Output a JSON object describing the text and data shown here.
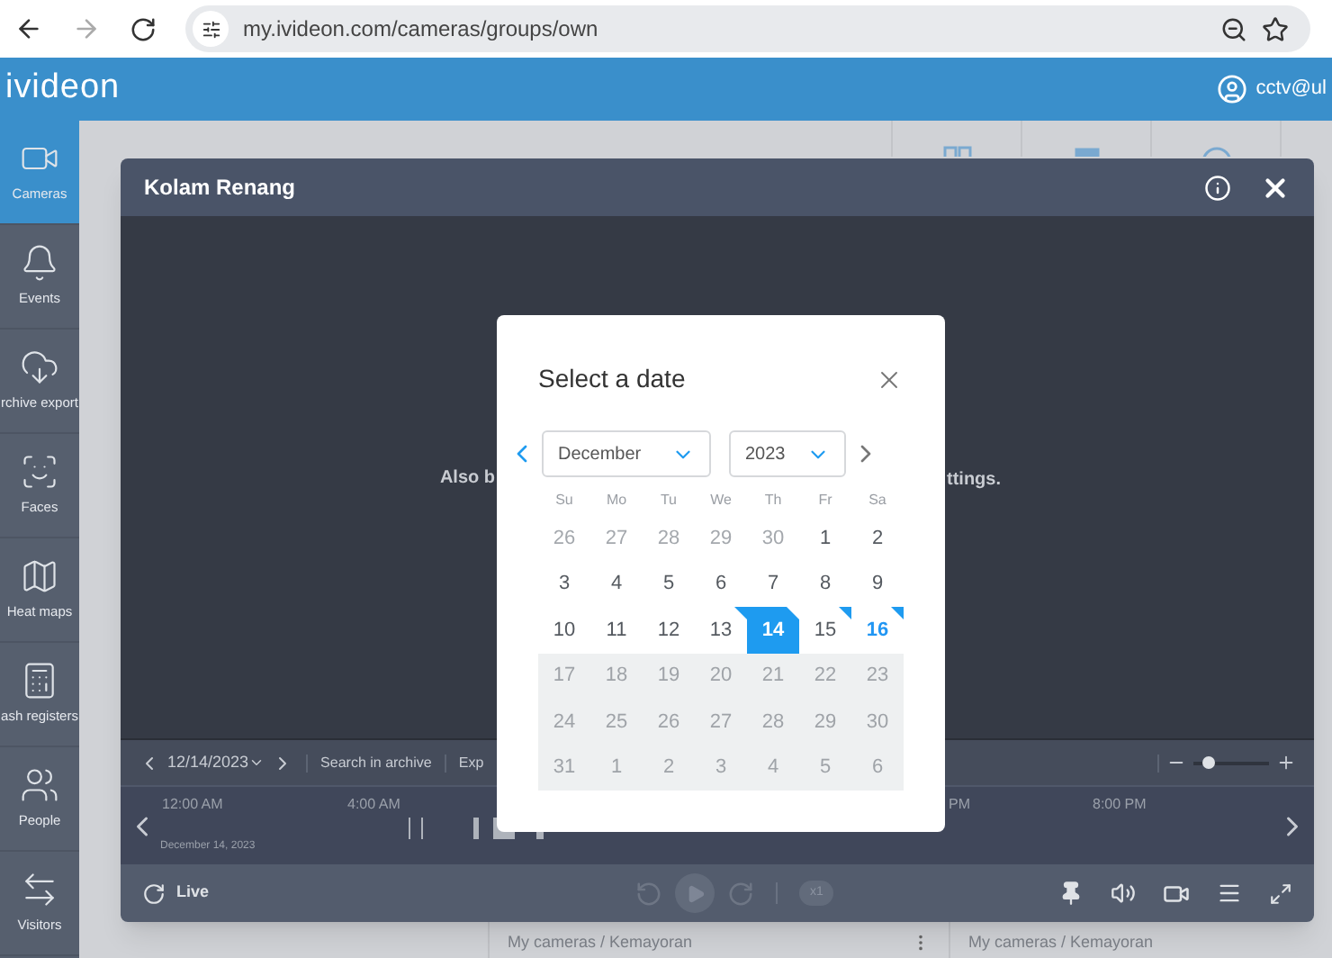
{
  "browser": {
    "url": "my.ivideon.com/cameras/groups/own",
    "forward_disabled": true
  },
  "header": {
    "logo": "ivideon",
    "user": "cctv@ul"
  },
  "sidebar": {
    "items": [
      {
        "label": "Cameras",
        "kind": "camera",
        "selected": true
      },
      {
        "label": "Events",
        "kind": "bell",
        "selected": false
      },
      {
        "label": "rchive export",
        "kind": "cloud",
        "selected": false
      },
      {
        "label": "Faces",
        "kind": "face",
        "selected": false
      },
      {
        "label": "Heat maps",
        "kind": "map",
        "selected": false
      },
      {
        "label": "ash registers",
        "kind": "register",
        "selected": false
      },
      {
        "label": "People",
        "kind": "people",
        "selected": false
      },
      {
        "label": "Visitors",
        "kind": "visitors",
        "selected": false
      }
    ]
  },
  "page": {
    "cards": [
      {
        "subtitle": "My cameras / Kemayoran"
      },
      {
        "subtitle": "My cameras / Kemayoran"
      }
    ]
  },
  "player": {
    "title": "Kolam Renang",
    "message_left": "Also b",
    "message_right": "ttings.",
    "date": "12/14/2023",
    "search": "Search in archive",
    "export": "Exp",
    "zoom": {
      "level": 0.2
    },
    "timeline": {
      "ticks": [
        {
          "label": "12:00 AM"
        },
        {
          "label": "4:00 AM"
        },
        {
          "label": "PM"
        },
        {
          "label": "8:00 PM"
        }
      ],
      "date": "December 14, 2023"
    },
    "live": "Live",
    "speed": "x1"
  },
  "date_dialog": {
    "title": "Select a date",
    "month": "December",
    "year": "2023",
    "weekdays": [
      "Su",
      "Mo",
      "Tu",
      "We",
      "Th",
      "Fr",
      "Sa"
    ],
    "days": [
      {
        "label": "26",
        "kind": "outside",
        "selected": false,
        "recorded": false,
        "today": false
      },
      {
        "label": "27",
        "kind": "outside",
        "selected": false,
        "recorded": false,
        "today": false
      },
      {
        "label": "28",
        "kind": "outside",
        "selected": false,
        "recorded": false,
        "today": false
      },
      {
        "label": "29",
        "kind": "outside",
        "selected": false,
        "recorded": false,
        "today": false
      },
      {
        "label": "30",
        "kind": "outside",
        "selected": false,
        "recorded": false,
        "today": false
      },
      {
        "label": "1",
        "kind": "normal",
        "selected": false,
        "recorded": false,
        "today": false
      },
      {
        "label": "2",
        "kind": "normal",
        "selected": false,
        "recorded": false,
        "today": false
      },
      {
        "label": "3",
        "kind": "normal",
        "selected": false,
        "recorded": false,
        "today": false
      },
      {
        "label": "4",
        "kind": "normal",
        "selected": false,
        "recorded": false,
        "today": false
      },
      {
        "label": "5",
        "kind": "normal",
        "selected": false,
        "recorded": false,
        "today": false
      },
      {
        "label": "6",
        "kind": "normal",
        "selected": false,
        "recorded": false,
        "today": false
      },
      {
        "label": "7",
        "kind": "normal",
        "selected": false,
        "recorded": false,
        "today": false
      },
      {
        "label": "8",
        "kind": "normal",
        "selected": false,
        "recorded": false,
        "today": false
      },
      {
        "label": "9",
        "kind": "normal",
        "selected": false,
        "recorded": false,
        "today": false
      },
      {
        "label": "10",
        "kind": "normal",
        "selected": false,
        "recorded": false,
        "today": false
      },
      {
        "label": "11",
        "kind": "normal",
        "selected": false,
        "recorded": false,
        "today": false
      },
      {
        "label": "12",
        "kind": "normal",
        "selected": false,
        "recorded": false,
        "today": false
      },
      {
        "label": "13",
        "kind": "normal",
        "selected": false,
        "recorded": true,
        "today": false
      },
      {
        "label": "14",
        "kind": "normal",
        "selected": true,
        "recorded": true,
        "today": false
      },
      {
        "label": "15",
        "kind": "normal",
        "selected": false,
        "recorded": true,
        "today": false
      },
      {
        "label": "16",
        "kind": "normal",
        "selected": false,
        "recorded": true,
        "today": true
      },
      {
        "label": "17",
        "kind": "future",
        "selected": false,
        "recorded": false,
        "today": false
      },
      {
        "label": "18",
        "kind": "future",
        "selected": false,
        "recorded": false,
        "today": false
      },
      {
        "label": "19",
        "kind": "future",
        "selected": false,
        "recorded": false,
        "today": false
      },
      {
        "label": "20",
        "kind": "future",
        "selected": false,
        "recorded": false,
        "today": false
      },
      {
        "label": "21",
        "kind": "future",
        "selected": false,
        "recorded": false,
        "today": false
      },
      {
        "label": "22",
        "kind": "future",
        "selected": false,
        "recorded": false,
        "today": false
      },
      {
        "label": "23",
        "kind": "future",
        "selected": false,
        "recorded": false,
        "today": false
      },
      {
        "label": "24",
        "kind": "future",
        "selected": false,
        "recorded": false,
        "today": false
      },
      {
        "label": "25",
        "kind": "future",
        "selected": false,
        "recorded": false,
        "today": false
      },
      {
        "label": "26",
        "kind": "future",
        "selected": false,
        "recorded": false,
        "today": false
      },
      {
        "label": "27",
        "kind": "future",
        "selected": false,
        "recorded": false,
        "today": false
      },
      {
        "label": "28",
        "kind": "future",
        "selected": false,
        "recorded": false,
        "today": false
      },
      {
        "label": "29",
        "kind": "future",
        "selected": false,
        "recorded": false,
        "today": false
      },
      {
        "label": "30",
        "kind": "future",
        "selected": false,
        "recorded": false,
        "today": false
      },
      {
        "label": "31",
        "kind": "future",
        "selected": false,
        "recorded": false,
        "today": false
      },
      {
        "label": "1",
        "kind": "future",
        "selected": false,
        "recorded": false,
        "today": false
      },
      {
        "label": "2",
        "kind": "future",
        "selected": false,
        "recorded": false,
        "today": false
      },
      {
        "label": "3",
        "kind": "future",
        "selected": false,
        "recorded": false,
        "today": false
      },
      {
        "label": "4",
        "kind": "future",
        "selected": false,
        "recorded": false,
        "today": false
      },
      {
        "label": "5",
        "kind": "future",
        "selected": false,
        "recorded": false,
        "today": false
      },
      {
        "label": "6",
        "kind": "future",
        "selected": false,
        "recorded": false,
        "today": false
      }
    ]
  }
}
